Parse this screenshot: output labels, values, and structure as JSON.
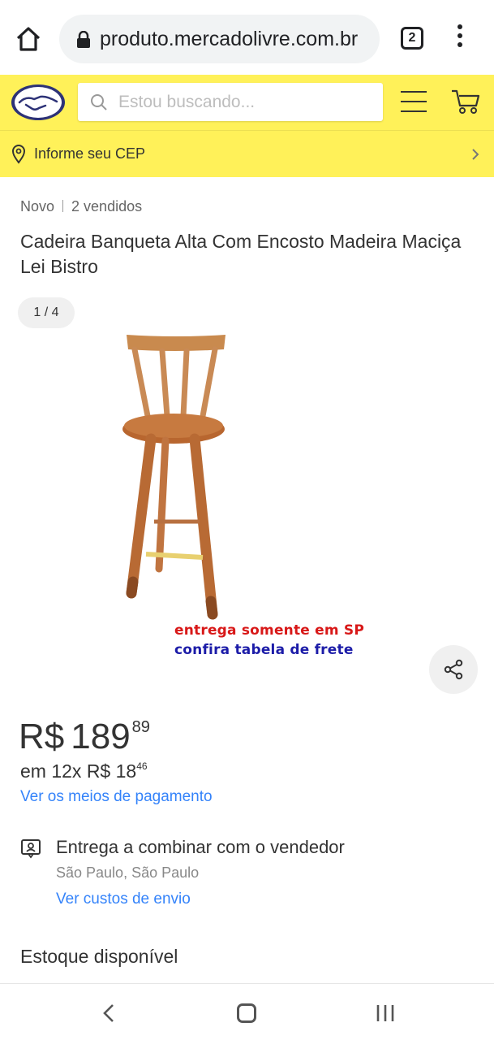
{
  "browser": {
    "url": "produto.mercadolivre.com.br",
    "tab_count": "2",
    "icons": [
      "home-icon",
      "lock-icon",
      "tabs-icon",
      "more-vert-icon"
    ]
  },
  "header": {
    "search_placeholder": "Estou buscando...",
    "cep_label": "Informe seu CEP",
    "brand_color": "#fff159",
    "icons": [
      "mercadolivre-logo-icon",
      "search-icon",
      "menu-icon",
      "cart-icon",
      "location-pin-icon",
      "chevron-right-icon"
    ]
  },
  "product": {
    "condition": "Novo",
    "sold": "2 vendidos",
    "title": "Cadeira Banqueta Alta Com Encosto Madeira Maciça Lei Bistro",
    "image_counter": "1 / 4",
    "promo_line_1": "entrega somente em SP",
    "promo_line_2": "confira tabela de frete",
    "promo_color_1": "#d81818",
    "promo_color_2": "#1c1ca8"
  },
  "price": {
    "currency": "R$",
    "amount": "189",
    "cents": "89",
    "installment_prefix": "em 12x R$ 18",
    "installment_cents": "46",
    "payment_link": "Ver os meios de pagamento",
    "link_color": "#3483fa"
  },
  "shipping": {
    "title": "Entrega a combinar com o vendedor",
    "location": "São Paulo, São Paulo",
    "link": "Ver custos de envio"
  },
  "stock": {
    "title": "Estoque disponível"
  },
  "navbar": {
    "icons": [
      "back-icon",
      "home-circle-icon",
      "recent-apps-icon"
    ]
  }
}
